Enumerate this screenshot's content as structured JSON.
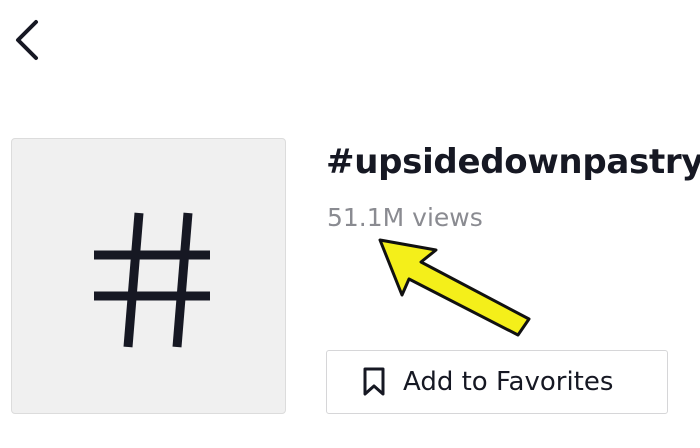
{
  "header": {
    "back_icon": "chevron-left-icon"
  },
  "hashtag": {
    "tile_icon": "hashtag-icon",
    "title": "#upsidedownpastry",
    "views": "51.1M views"
  },
  "actions": {
    "favorite_icon": "bookmark-icon",
    "favorite_label": "Add to Favorites"
  },
  "annotation": {
    "arrow_color": "#f4ef1a",
    "arrow_outline": "#111111"
  },
  "colors": {
    "title_text": "#161823",
    "secondary_text": "#8a8b91",
    "tile_background": "#f0f0f0",
    "border": "#d6d6d8"
  }
}
